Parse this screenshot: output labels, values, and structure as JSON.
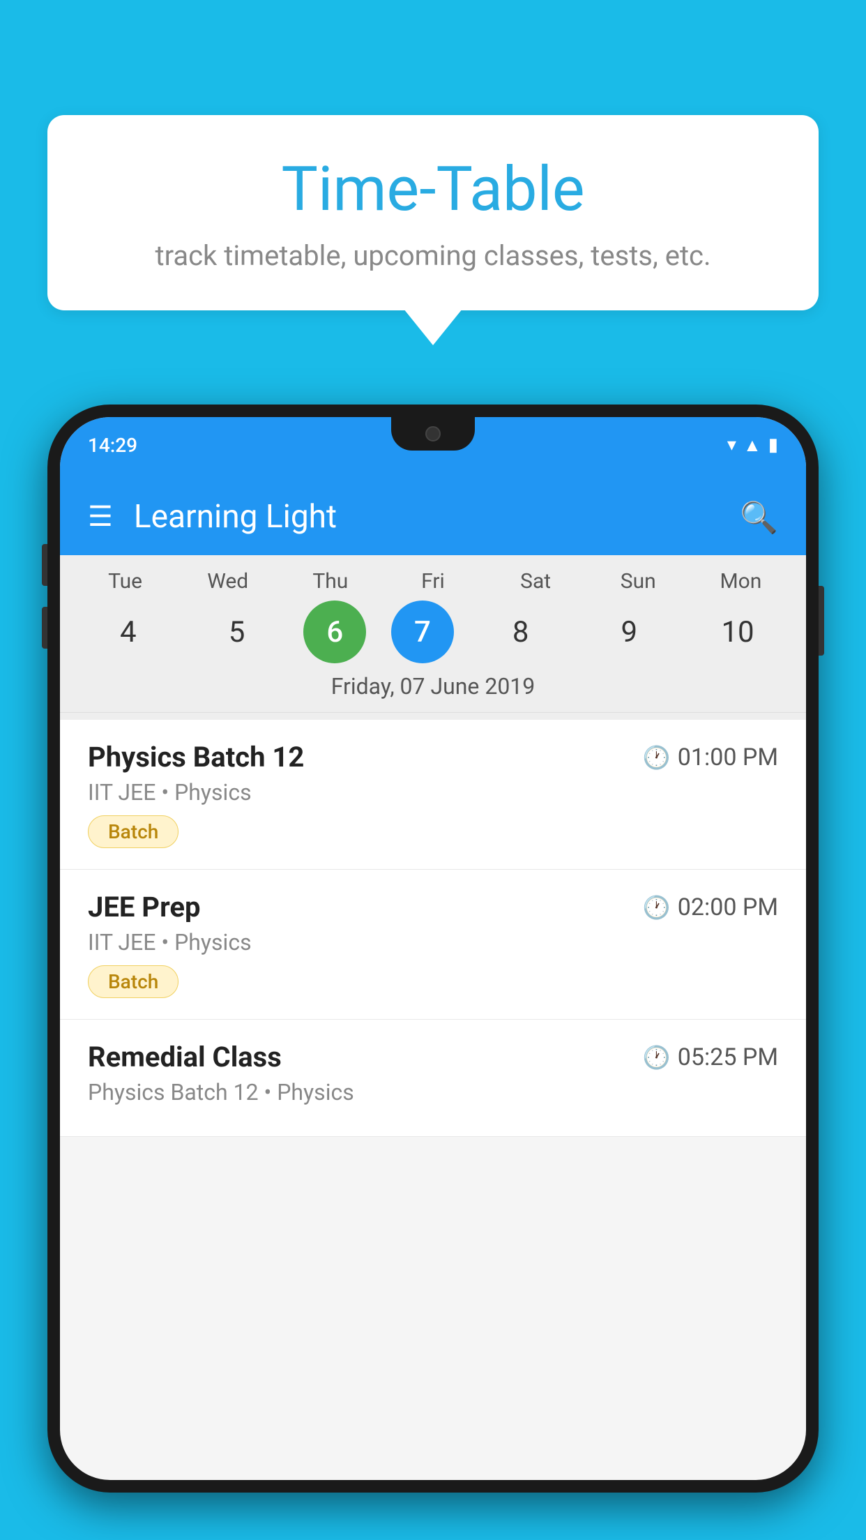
{
  "background_color": "#1ABBE8",
  "speech_bubble": {
    "title": "Time-Table",
    "subtitle": "track timetable, upcoming classes, tests, etc."
  },
  "app": {
    "name": "Learning Light",
    "status_time": "14:29"
  },
  "calendar": {
    "days": [
      {
        "label": "Tue",
        "number": "4",
        "state": "normal"
      },
      {
        "label": "Wed",
        "number": "5",
        "state": "normal"
      },
      {
        "label": "Thu",
        "number": "6",
        "state": "today"
      },
      {
        "label": "Fri",
        "number": "7",
        "state": "selected"
      },
      {
        "label": "Sat",
        "number": "8",
        "state": "normal"
      },
      {
        "label": "Sun",
        "number": "9",
        "state": "normal"
      },
      {
        "label": "Mon",
        "number": "10",
        "state": "normal"
      }
    ],
    "selected_date_label": "Friday, 07 June 2019"
  },
  "schedule": [
    {
      "title": "Physics Batch 12",
      "time": "01:00 PM",
      "subtitle": "IIT JEE • Physics",
      "badge": "Batch"
    },
    {
      "title": "JEE Prep",
      "time": "02:00 PM",
      "subtitle": "IIT JEE • Physics",
      "badge": "Batch"
    },
    {
      "title": "Remedial Class",
      "time": "05:25 PM",
      "subtitle": "Physics Batch 12 • Physics",
      "badge": null
    }
  ],
  "icons": {
    "menu": "☰",
    "search": "🔍",
    "clock": "🕐"
  }
}
